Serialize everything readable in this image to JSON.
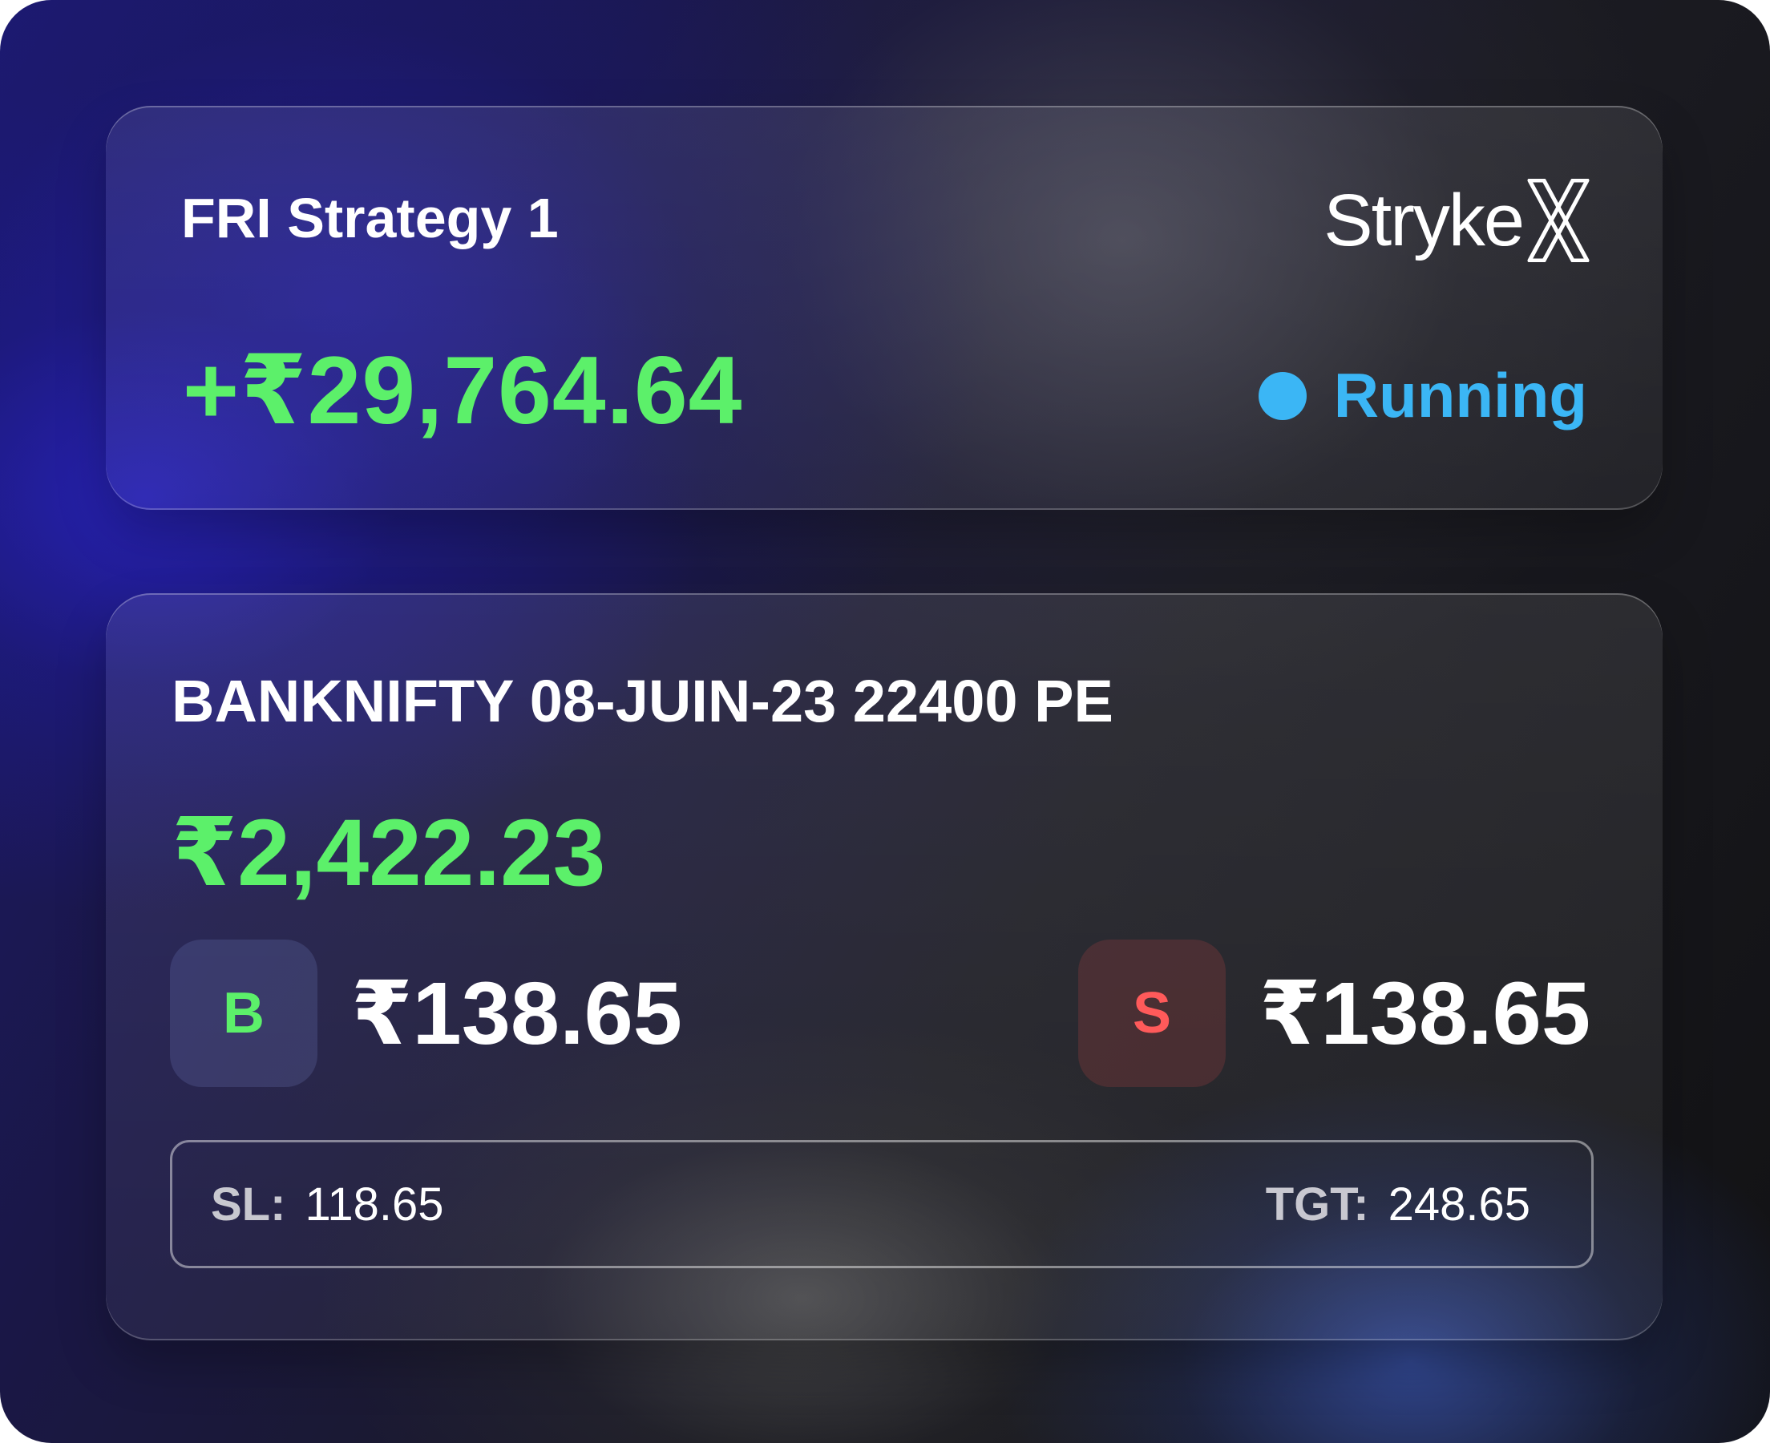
{
  "strategy": {
    "name": "FRI Strategy 1",
    "brand": "StrykeX",
    "brand_letters": "Stryke",
    "total_pnl": "+₹29,764.64",
    "status": "Running",
    "status_color": "#3bb6f5"
  },
  "position": {
    "instrument": "BANKNIFTY 08-JUIN-23 22400 PE",
    "pnl": "₹2,422.23",
    "buy": {
      "badge": "B",
      "price": "₹138.65",
      "color": "#5cf06a"
    },
    "sell": {
      "badge": "S",
      "price": "₹138.65",
      "color": "#ff5a5a"
    },
    "stop_loss": {
      "label": "SL:",
      "value": "118.65"
    },
    "target": {
      "label": "TGT:",
      "value": "248.65"
    }
  },
  "colors": {
    "profit": "#5cf06a",
    "loss": "#ff5a5a",
    "running": "#3bb6f5"
  }
}
